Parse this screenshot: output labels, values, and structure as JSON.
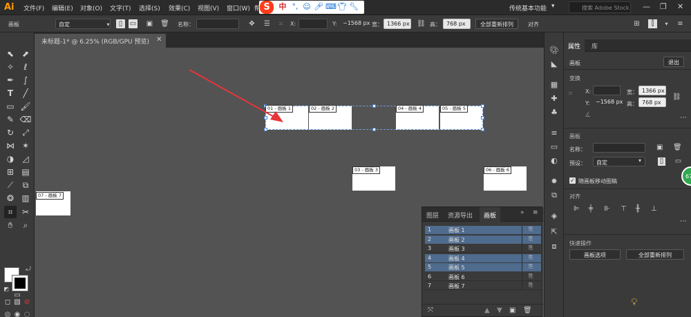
{
  "app": {
    "logo": "Ai"
  },
  "menu": {
    "items": [
      "文件(F)",
      "编辑(E)",
      "对象(O)",
      "文字(T)",
      "选择(S)",
      "效果(C)",
      "视图(V)",
      "窗口(W)",
      "帮"
    ],
    "workspace": "传统基本功能",
    "stock_search_placeholder": "搜索 Adobe Stock"
  },
  "ime": {
    "label": "S",
    "mode": "中"
  },
  "control_bar": {
    "panel_label": "画板",
    "preset": "自定",
    "name_label": "名称：",
    "name_value": "",
    "x_label": "X:",
    "x_value": "",
    "y_label": "Y:",
    "y_value": "−1568 px",
    "w_label": "宽：",
    "w_value": "1366 px",
    "h_label": "高：",
    "h_value": "768 px",
    "rearrange_button": "全部重新排列",
    "align_label": "对齐"
  },
  "document": {
    "tab_title": "未标题-1* @ 6.25% (RGB/GPU 预览)"
  },
  "artboards": {
    "labels": [
      "01 - 画板 1",
      "02 - 画板 2",
      "03 - 画板 3",
      "04 - 画板 4",
      "05 - 画板 5",
      "06 - 画板 6",
      "07 - 画板 7"
    ]
  },
  "artboards_panel": {
    "tabs": [
      "图层",
      "资源导出",
      "画板"
    ],
    "active_tab": "画板",
    "rows": [
      {
        "num": "1",
        "name": "画板 1",
        "selected": true
      },
      {
        "num": "2",
        "name": "画板 2",
        "selected": true
      },
      {
        "num": "3",
        "name": "画板 3",
        "selected": false
      },
      {
        "num": "4",
        "name": "画板 4",
        "selected": true
      },
      {
        "num": "5",
        "name": "画板 5",
        "selected": true
      },
      {
        "num": "6",
        "name": "画板 6",
        "selected": false
      },
      {
        "num": "7",
        "name": "画板 7",
        "selected": false
      }
    ]
  },
  "properties": {
    "tabs": [
      "属性",
      "库"
    ],
    "section_artboard": "画板",
    "exit_button": "退出",
    "transform_title": "变换",
    "x_label": "X:",
    "x_value": "",
    "y_label": "Y:",
    "y_value": "−1568 px",
    "w_label": "宽：",
    "w_value": "1366 px",
    "h_label": "高：",
    "h_value": "768 px",
    "artboard_title": "画板",
    "name_label": "名称：",
    "name_value": "",
    "preset_label": "预设：",
    "preset_value": "自定",
    "move_with_artboard": "随画板移动图稿",
    "move_with_artboard_checked": true,
    "align_title": "对齐",
    "quick_actions_title": "快速操作",
    "artboard_options_button": "画板选项",
    "rearrange_all_button": "全部重新排列",
    "badge": "67"
  },
  "colors": {
    "canvas": "#535353",
    "panel": "#3a3a3a",
    "selection_row": "#4f6b8d",
    "accent_orange": "#ff9a00",
    "arrow_red": "#e8343a"
  }
}
